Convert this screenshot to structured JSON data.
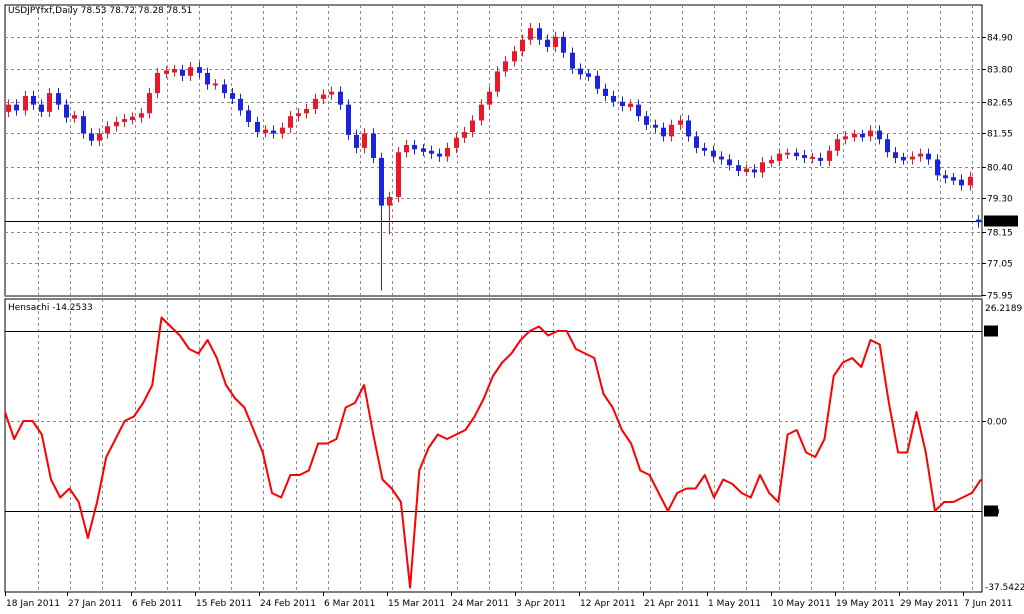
{
  "price_panel": {
    "header": "USDJPYfxf,Daily  78.53 78.72 78.28 78.51",
    "current_price_label": "78.51",
    "axis_labels": [
      "84.90",
      "83.80",
      "82.65",
      "81.55",
      "80.40",
      "79.30",
      "78.15",
      "77.05",
      "75.95"
    ]
  },
  "indicator_panel": {
    "header": "Hensachi -14.2533",
    "top_value": "26.2189",
    "bottom_value": "-37.5422",
    "level_labels": [
      "20",
      "0.00",
      "-20"
    ]
  },
  "date_axis": {
    "labels": [
      "18 Jan 2011",
      "27 Jan 2011",
      "6 Feb 2011",
      "15 Feb 2011",
      "24 Feb 2011",
      "6 Mar 2011",
      "15 Mar 2011",
      "24 Mar 2011",
      "3 Apr 2011",
      "12 Apr 2011",
      "21 Apr 2011",
      "1 May 2011",
      "10 May 2011",
      "19 May 2011",
      "29 May 2011",
      "7 Jun 2011"
    ]
  },
  "colors": {
    "bull": "#e8182a",
    "bear": "#1a23e0",
    "line": "#ff0000",
    "grid": "#8a8a8a"
  },
  "chart_data": [
    {
      "type": "candlestick",
      "title": "USDJPYfxf,Daily",
      "ylim": [
        75.95,
        85.9
      ],
      "last": {
        "open": 78.53,
        "high": 78.72,
        "low": 78.28,
        "close": 78.51
      },
      "close": [
        82.55,
        82.35,
        82.85,
        82.55,
        82.3,
        82.95,
        82.55,
        82.1,
        82.15,
        81.55,
        81.3,
        81.55,
        81.8,
        81.95,
        82.05,
        82.1,
        82.25,
        82.95,
        83.65,
        83.7,
        83.75,
        83.55,
        83.85,
        83.65,
        83.25,
        83.25,
        82.95,
        82.75,
        82.35,
        81.95,
        81.6,
        81.65,
        81.55,
        81.75,
        82.15,
        82.25,
        82.4,
        82.75,
        82.9,
        83.0,
        82.55,
        81.5,
        81.05,
        81.55,
        80.7,
        79.05,
        79.35,
        80.9,
        81.15,
        81.0,
        80.95,
        80.85,
        80.75,
        81.05,
        81.4,
        81.6,
        82.0,
        82.55,
        83.0,
        83.7,
        84.05,
        84.4,
        84.8,
        85.2,
        84.8,
        84.55,
        84.9,
        84.35,
        83.8,
        83.6,
        83.55,
        83.1,
        82.85,
        82.65,
        82.5,
        82.55,
        82.15,
        81.85,
        81.75,
        81.45,
        81.85,
        82.0,
        81.45,
        81.05,
        80.95,
        80.75,
        80.65,
        80.45,
        80.25,
        80.3,
        80.2,
        80.55,
        80.6,
        80.85,
        80.85,
        80.8,
        80.7,
        80.7,
        80.6,
        80.95,
        81.35,
        81.45,
        81.5,
        81.45,
        81.65,
        81.35,
        80.9,
        80.7,
        80.65,
        80.75,
        80.85,
        80.65,
        80.1,
        80.0,
        79.95,
        79.75,
        80.05,
        78.51
      ]
    },
    {
      "type": "line",
      "title": "Hensachi",
      "ylim": [
        -37.5422,
        26.2189
      ],
      "levels": [
        20,
        0,
        -20
      ],
      "values": [
        2,
        -4,
        0,
        0,
        -3,
        -13,
        -17,
        -15,
        -18,
        -26,
        -18,
        -8,
        -4,
        0,
        1,
        4,
        8,
        23,
        21,
        19,
        16,
        15,
        18,
        14,
        8,
        5,
        3,
        -2,
        -7,
        -16,
        -17,
        -12,
        -12,
        -11,
        -5,
        -5,
        -4,
        3,
        4,
        8,
        -3,
        -13,
        -15,
        -18,
        -37,
        -11,
        -6,
        -3,
        -4,
        -3,
        -2,
        1,
        5,
        10,
        13,
        15,
        18,
        20,
        21,
        19,
        20,
        20,
        16,
        15,
        14,
        6,
        3,
        -2,
        -5,
        -11,
        -12,
        -16,
        -20,
        -16,
        -15,
        -15,
        -12,
        -17,
        -13,
        -14,
        -16,
        -17,
        -12,
        -16,
        -18,
        -3,
        -2,
        -7,
        -8,
        -4,
        10,
        13,
        14,
        12,
        18,
        17,
        4,
        -7,
        -7,
        2,
        -7,
        -20,
        -18,
        -18,
        -17,
        -16,
        -13
      ]
    }
  ]
}
